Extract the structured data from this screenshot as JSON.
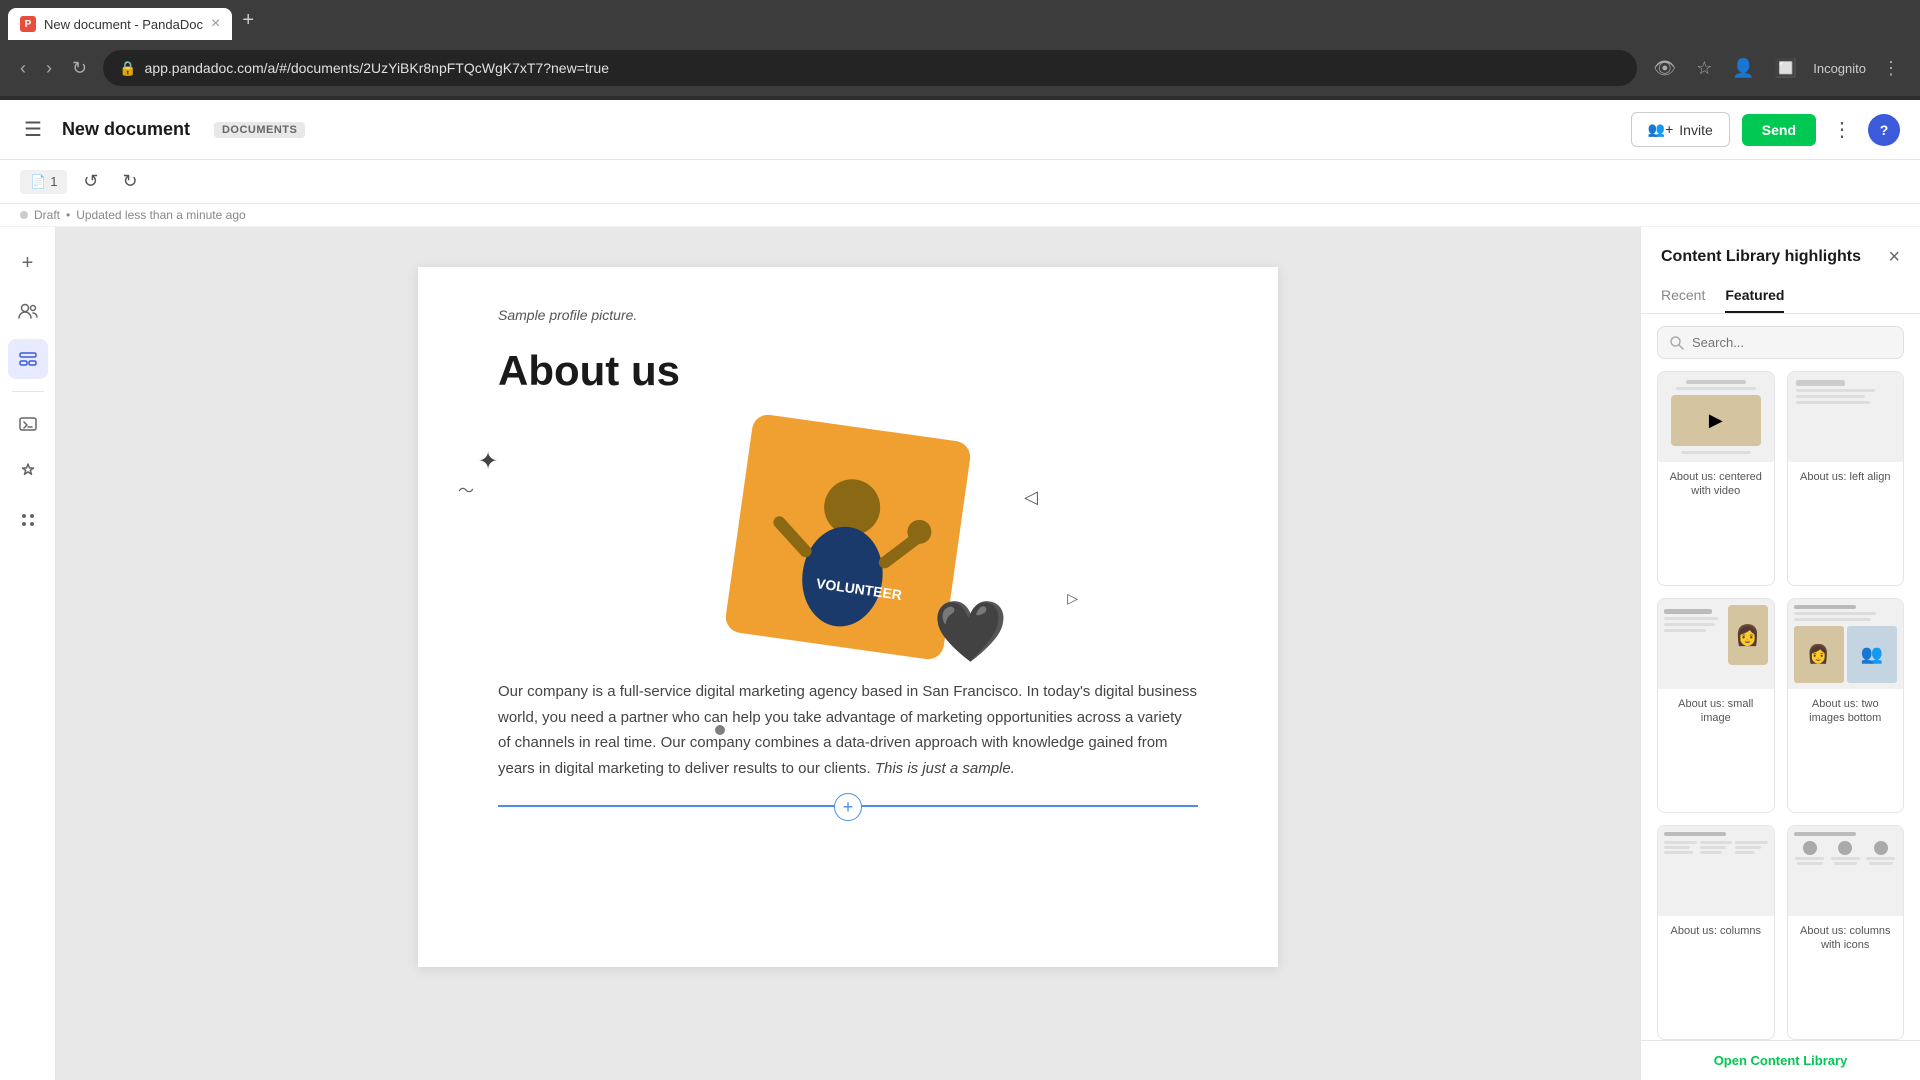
{
  "browser": {
    "url": "app.pandadoc.com/a/#/documents/2UzYiBKr8npFTQcWgK7xT7?new=true",
    "tab_title": "New document - PandaDoc",
    "tab_favicon": "P",
    "incognito_label": "Incognito"
  },
  "header": {
    "menu_icon": "☰",
    "doc_title": "New document",
    "doc_badge": "DOCUMENTS",
    "draft_label": "Draft",
    "updated_label": "Updated less than a minute ago",
    "invite_label": "Invite",
    "send_label": "Send",
    "more_icon": "⋮",
    "help_label": "?"
  },
  "toolbar": {
    "page_num": "1",
    "undo_icon": "↺",
    "redo_icon": "↻"
  },
  "sidebar_icons": [
    {
      "id": "add",
      "icon": "+",
      "active": false
    },
    {
      "id": "recipients",
      "icon": "👥",
      "active": false
    },
    {
      "id": "form-fields",
      "icon": "⊞",
      "active": true
    },
    {
      "id": "variables",
      "icon": "{ }",
      "active": false
    },
    {
      "id": "integrations",
      "icon": "⚙",
      "active": false
    },
    {
      "id": "apps",
      "icon": "⠿",
      "active": false
    }
  ],
  "document": {
    "sample_caption": "Sample profile picture.",
    "heading": "About us",
    "body_text": "Our company is a full-service digital marketing agency based in San Francisco. In today's digital business world, you need a partner who can help you take advantage of marketing opportunities across a variety of channels in real time. Our company combines a data-driven approach with knowledge gained from years in digital marketing to deliver results to our clients.",
    "italic_text": "This is just a sample.",
    "add_block_label": "+"
  },
  "content_library": {
    "title": "Content Library highlights",
    "close_icon": "×",
    "tabs": [
      {
        "id": "recent",
        "label": "Recent"
      },
      {
        "id": "featured",
        "label": "Featured"
      }
    ],
    "active_tab": "featured",
    "search_placeholder": "Search...",
    "cards": [
      {
        "id": "about-us-centered-video",
        "label": "About us: centered with video",
        "thumb_type": "centered-video"
      },
      {
        "id": "about-us-left-align",
        "label": "About us: left align",
        "thumb_type": "left-align"
      },
      {
        "id": "about-us-small-image",
        "label": "About us: small image",
        "thumb_type": "small-image"
      },
      {
        "id": "about-us-two-images",
        "label": "About us: two images bottom",
        "thumb_type": "two-images"
      },
      {
        "id": "about-us-columns",
        "label": "About us: columns",
        "thumb_type": "columns"
      },
      {
        "id": "about-us-columns-icons",
        "label": "About us: columns with icons",
        "thumb_type": "columns-icons"
      }
    ],
    "open_library_label": "Open Content Library"
  }
}
